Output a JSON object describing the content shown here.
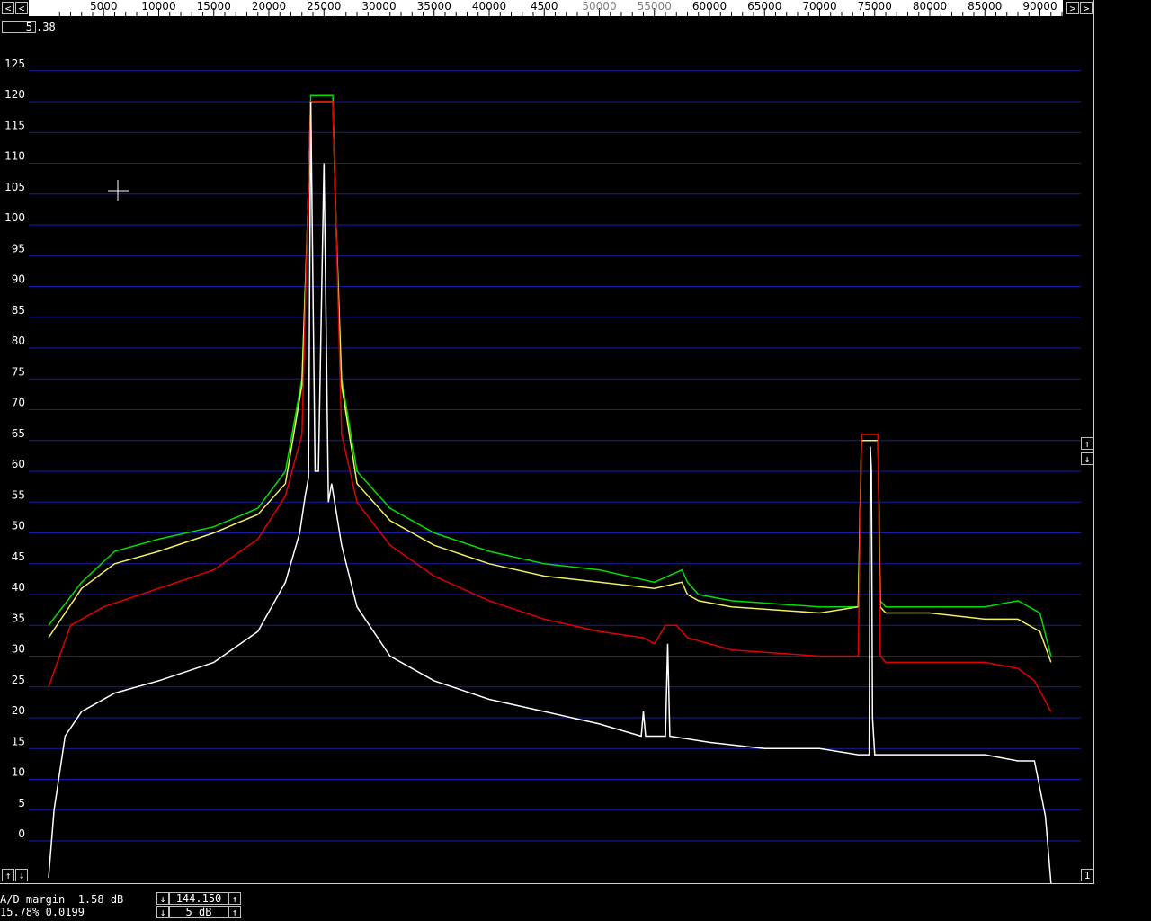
{
  "window": {
    "avg_value": "5",
    "avg_suffix": ".38"
  },
  "ruler": {
    "left_button": "<",
    "right_button": ">",
    "ticks_left": [
      "5000",
      "10000",
      "15000",
      "20000",
      "25000",
      "30000",
      "35000",
      "40000",
      "4500"
    ],
    "ticks_right": [
      "60000",
      "65000",
      "70000",
      "75000",
      "80000",
      "85000",
      "90000"
    ],
    "ticks_dim": [
      "50000",
      "55000"
    ]
  },
  "scroll_buttons": {
    "up": "↑",
    "down": "↓",
    "one": "1"
  },
  "status": {
    "ad_margin": "A/D margin  1.58 dB",
    "percent": "15.78% 0.0199",
    "freq": "144.150",
    "db_step": "5 dB"
  },
  "colors": {
    "grid": "#1a1aa8",
    "trace_green": "#00e000",
    "trace_yellow": "#f0f060",
    "trace_red": "#e00000",
    "trace_white": "#ffffff"
  },
  "chart_data": {
    "type": "line",
    "xlabel": "",
    "ylabel": "",
    "xlim": [
      0,
      95000
    ],
    "ylim": [
      0,
      125
    ],
    "y_ticks": [
      0,
      5,
      10,
      15,
      20,
      25,
      30,
      35,
      40,
      45,
      50,
      55,
      60,
      65,
      70,
      75,
      80,
      85,
      90,
      95,
      100,
      105,
      110,
      115,
      120,
      125
    ],
    "x_ticks": [
      5000,
      10000,
      15000,
      20000,
      25000,
      30000,
      35000,
      40000,
      45000,
      50000,
      55000,
      60000,
      65000,
      70000,
      75000,
      80000,
      85000,
      90000
    ],
    "grid": true,
    "series": [
      {
        "color": "#00e000",
        "x": [
          0,
          3000,
          6000,
          10000,
          15000,
          19000,
          21500,
          23000,
          23500,
          23800,
          25800,
          26100,
          26600,
          28000,
          31000,
          35000,
          40000,
          45000,
          50000,
          55000,
          57500,
          58000,
          59000,
          62000,
          70000,
          73500,
          73800,
          75300,
          75500,
          76000,
          80000,
          85000,
          88000,
          90000,
          91000
        ],
        "values": [
          35,
          42,
          47,
          49,
          51,
          54,
          60,
          75,
          100,
          121,
          121,
          100,
          75,
          60,
          54,
          50,
          47,
          45,
          44,
          42,
          44,
          42,
          40,
          39,
          38,
          38,
          66,
          66,
          39,
          38,
          38,
          38,
          39,
          37,
          30
        ]
      },
      {
        "color": "#f0f060",
        "x": [
          0,
          3000,
          6000,
          10000,
          15000,
          19000,
          21500,
          23000,
          23500,
          23800,
          25800,
          26100,
          26600,
          28000,
          31000,
          35000,
          40000,
          45000,
          50000,
          55000,
          57500,
          58000,
          59000,
          62000,
          70000,
          73500,
          73800,
          75300,
          75500,
          76000,
          80000,
          85000,
          88000,
          90000,
          91000
        ],
        "values": [
          33,
          41,
          45,
          47,
          50,
          53,
          58,
          74,
          100,
          120,
          120,
          100,
          74,
          58,
          52,
          48,
          45,
          43,
          42,
          41,
          42,
          40,
          39,
          38,
          37,
          38,
          65,
          65,
          38,
          37,
          37,
          36,
          36,
          34,
          29
        ]
      },
      {
        "color": "#e00000",
        "x": [
          0,
          2000,
          5000,
          10000,
          15000,
          19000,
          21500,
          23000,
          23500,
          23800,
          25800,
          26100,
          26600,
          28000,
          31000,
          35000,
          40000,
          45000,
          50000,
          54000,
          55000,
          56000,
          57000,
          58000,
          62000,
          70000,
          73500,
          73800,
          75300,
          75500,
          76000,
          80000,
          85000,
          88000,
          89500,
          91000
        ],
        "values": [
          25,
          35,
          38,
          41,
          44,
          49,
          56,
          66,
          100,
          120,
          120,
          100,
          66,
          55,
          48,
          43,
          39,
          36,
          34,
          33,
          32,
          35,
          35,
          33,
          31,
          30,
          30,
          66,
          66,
          30,
          29,
          29,
          29,
          28,
          26,
          21
        ]
      },
      {
        "color": "#ffffff",
        "x": [
          0,
          500,
          1500,
          3000,
          6000,
          10000,
          15000,
          19000,
          21500,
          22800,
          23300,
          23600,
          23800,
          24200,
          24500,
          25000,
          25400,
          25700,
          26600,
          28000,
          31000,
          35000,
          40000,
          45000,
          50000,
          53800,
          54000,
          54200,
          56000,
          56200,
          56400,
          60000,
          65000,
          70000,
          73500,
          74500,
          74600,
          74700,
          74800,
          75000,
          80000,
          85000,
          88000,
          89500,
          90500,
          91000
        ],
        "values": [
          -6,
          5,
          17,
          21,
          24,
          26,
          29,
          34,
          42,
          50,
          56,
          59,
          120,
          60,
          60,
          110,
          55,
          58,
          48,
          38,
          30,
          26,
          23,
          21,
          19,
          17,
          21,
          17,
          17,
          32,
          17,
          16,
          15,
          15,
          14,
          14,
          64,
          60,
          20,
          14,
          14,
          14,
          13,
          13,
          4,
          -7
        ]
      }
    ]
  }
}
